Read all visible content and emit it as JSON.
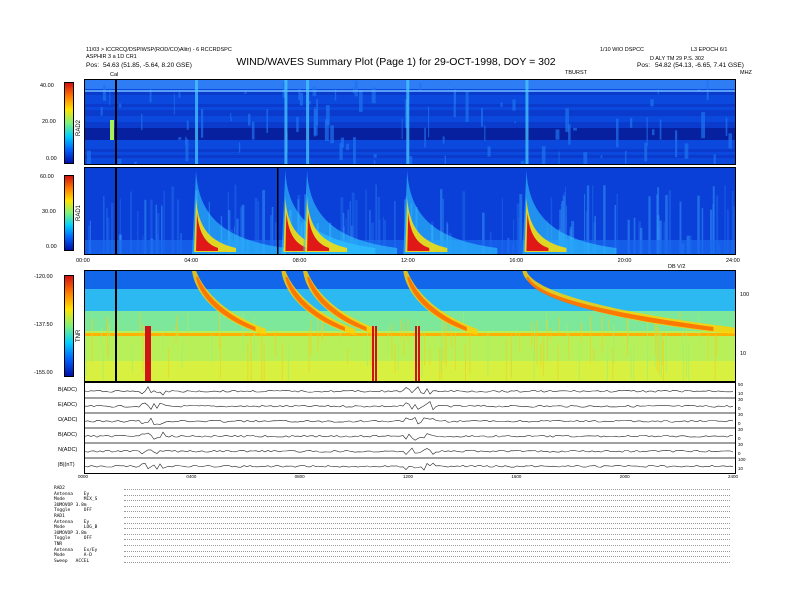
{
  "header": {
    "left_line1": "11/03 > ICCRCQ/DSPIWSP(ROD/CO)Alitr) - 6 RCCRDSPC",
    "left_line2": "ASPHIR 3 a 1D CR1",
    "right_top": "L3 EPOCH 6/1",
    "center_right": "1/10 WIO DSPCC",
    "right_line2": "D ALY  TM 29 P.S. 302",
    "title": "WIND/WAVES Summary Plot (Page 1) for 29-OCT-1998, DOY = 302",
    "pos_left_label": "Pos:",
    "pos_left": "54.63 (51.85, -5.64, 8.20 GSE)",
    "pos_right_label": "Pos:",
    "pos_right": "54.82 (54.13, -6.65, 7.41 GSE)",
    "cal_label": "Cal",
    "ticks_label": "TBURST",
    "mhz_label": "MHZ"
  },
  "chart_data": [
    {
      "type": "heatmap",
      "name": "RAD2",
      "ylabel": "RAD2",
      "ylim": [
        0,
        40
      ],
      "colorbar_ticks": [
        "40.00",
        "20.00",
        "0.00"
      ],
      "x_range_hours": [
        0,
        24
      ]
    },
    {
      "type": "heatmap",
      "name": "RAD1",
      "ylabel": "RAD1",
      "ylim": [
        0,
        60
      ],
      "colorbar_ticks": [
        "60.00",
        "30.00",
        "0.00"
      ],
      "x_range_hours": [
        0,
        24
      ],
      "x_ticks": [
        "00:00",
        "04:00",
        "08:00",
        "12:00",
        "16:00",
        "20:00",
        "24:00"
      ],
      "bursts_hours": [
        4.1,
        7.4,
        8.2,
        11.9,
        16.3
      ]
    },
    {
      "type": "heatmap",
      "name": "TNR",
      "ylabel": "TNR",
      "colorbar_ticks": [
        "-120.00",
        "-137.50",
        "-155.00"
      ],
      "right_ticks": [
        "100",
        "10"
      ],
      "x_range_hours": [
        0,
        24
      ],
      "mark_label": "DB V/2"
    },
    {
      "type": "line",
      "name": "housekeeping",
      "rows": [
        {
          "label": "B(ADC)",
          "right": [
            "50",
            "10"
          ]
        },
        {
          "label": "E(ADC)",
          "right": [
            "30",
            "0"
          ]
        },
        {
          "label": "Ω(ADC)",
          "right": [
            "30",
            "0"
          ]
        },
        {
          "label": "B(ADC)",
          "right": [
            "30",
            "0"
          ]
        },
        {
          "label": "N(ADC)",
          "right": [
            "30",
            "0"
          ]
        },
        {
          "label": "|B|(nT)",
          "right": [
            "100",
            "10"
          ]
        }
      ],
      "x_ticks": [
        "0000",
        "0400",
        "0800",
        "1200",
        "1600",
        "2000",
        "2400"
      ]
    }
  ],
  "settings_table": [
    "RAD2",
    "Antenna    Ey",
    "Mode       MIX_S",
    "3UMOVOP 3.8m",
    "Toggle     OFF",
    "RAD1",
    "Antenna    Ey",
    "Mode       LOG_B",
    "3UMOVOP 3.8m",
    "Toggle     OFF",
    "TNR",
    "Antenna    Ex/Ey",
    "Mode       A-D",
    "Sweep   ACCEL"
  ]
}
